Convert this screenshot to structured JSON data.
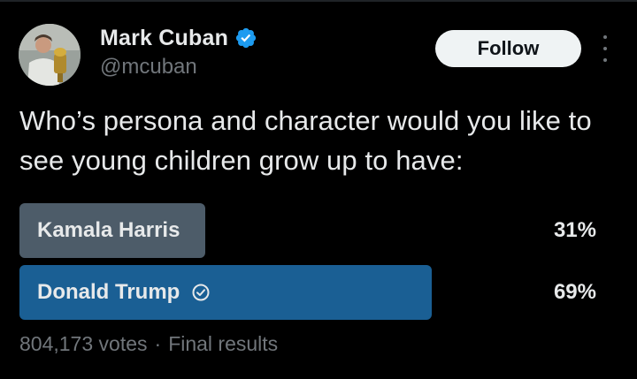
{
  "author": {
    "name": "Mark Cuban",
    "handle": "@mcuban",
    "verified": true
  },
  "actions": {
    "follow_label": "Follow"
  },
  "tweet": {
    "text": "Who’s persona and character would you like to see young children grow up to have:"
  },
  "poll": {
    "options": [
      {
        "label": "Kamala Harris",
        "percent_text": "31%",
        "percent": 31,
        "winner": false
      },
      {
        "label": "Donald Trump",
        "percent_text": "69%",
        "percent": 69,
        "winner": true
      }
    ],
    "votes": "804,173 votes",
    "separator": "·",
    "status": "Final results"
  },
  "colors": {
    "background": "#000000",
    "text_primary": "#e7e9ea",
    "text_secondary": "#71767b",
    "verified_blue": "#1d9bf0",
    "bar_winner": "#1a5f94",
    "bar_other": "#4d5c69",
    "follow_bg": "#eff3f4"
  },
  "icons": {
    "verified": "verified-badge-icon",
    "winner_check": "check-circle-icon",
    "more": "more-dots-icon"
  }
}
